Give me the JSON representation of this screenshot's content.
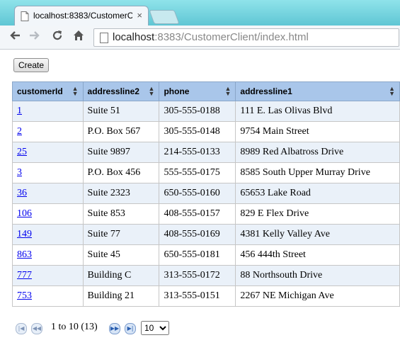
{
  "browser": {
    "tab_title": "localhost:8383/CustomerC",
    "tab_close": "×",
    "url_host": "localhost",
    "url_rest": ":8383/CustomerClient/index.html"
  },
  "page": {
    "create_label": "Create",
    "columns": [
      "customerId",
      "addressline2",
      "phone",
      "addressline1"
    ],
    "rows": [
      {
        "customerId": "1",
        "addressline2": "Suite 51",
        "phone": "305-555-0188",
        "addressline1": "111 E. Las Olivas Blvd"
      },
      {
        "customerId": "2",
        "addressline2": "P.O. Box 567",
        "phone": "305-555-0148",
        "addressline1": "9754 Main Street"
      },
      {
        "customerId": "25",
        "addressline2": "Suite 9897",
        "phone": "214-555-0133",
        "addressline1": "8989 Red Albatross Drive"
      },
      {
        "customerId": "3",
        "addressline2": "P.O. Box 456",
        "phone": "555-555-0175",
        "addressline1": "8585 South Upper Murray Drive"
      },
      {
        "customerId": "36",
        "addressline2": "Suite 2323",
        "phone": "650-555-0160",
        "addressline1": "65653 Lake Road"
      },
      {
        "customerId": "106",
        "addressline2": "Suite 853",
        "phone": "408-555-0157",
        "addressline1": "829 E Flex Drive"
      },
      {
        "customerId": "149",
        "addressline2": "Suite 77",
        "phone": "408-555-0169",
        "addressline1": "4381 Kelly Valley Ave"
      },
      {
        "customerId": "863",
        "addressline2": "Suite 45",
        "phone": "650-555-0181",
        "addressline1": "456 444th Street"
      },
      {
        "customerId": "777",
        "addressline2": "Building C",
        "phone": "313-555-0172",
        "addressline1": "88 Northsouth Drive"
      },
      {
        "customerId": "753",
        "addressline2": "Building 21",
        "phone": "313-555-0151",
        "addressline1": "2267 NE Michigan Ave"
      }
    ],
    "pager": {
      "info": "1 to 10 (13)",
      "page_size": "10",
      "page_size_options": [
        "10"
      ]
    }
  },
  "colors": {
    "header_bg": "#a9c6ea",
    "odd_row_bg": "#eaf1f9",
    "link": "#0000ee"
  }
}
